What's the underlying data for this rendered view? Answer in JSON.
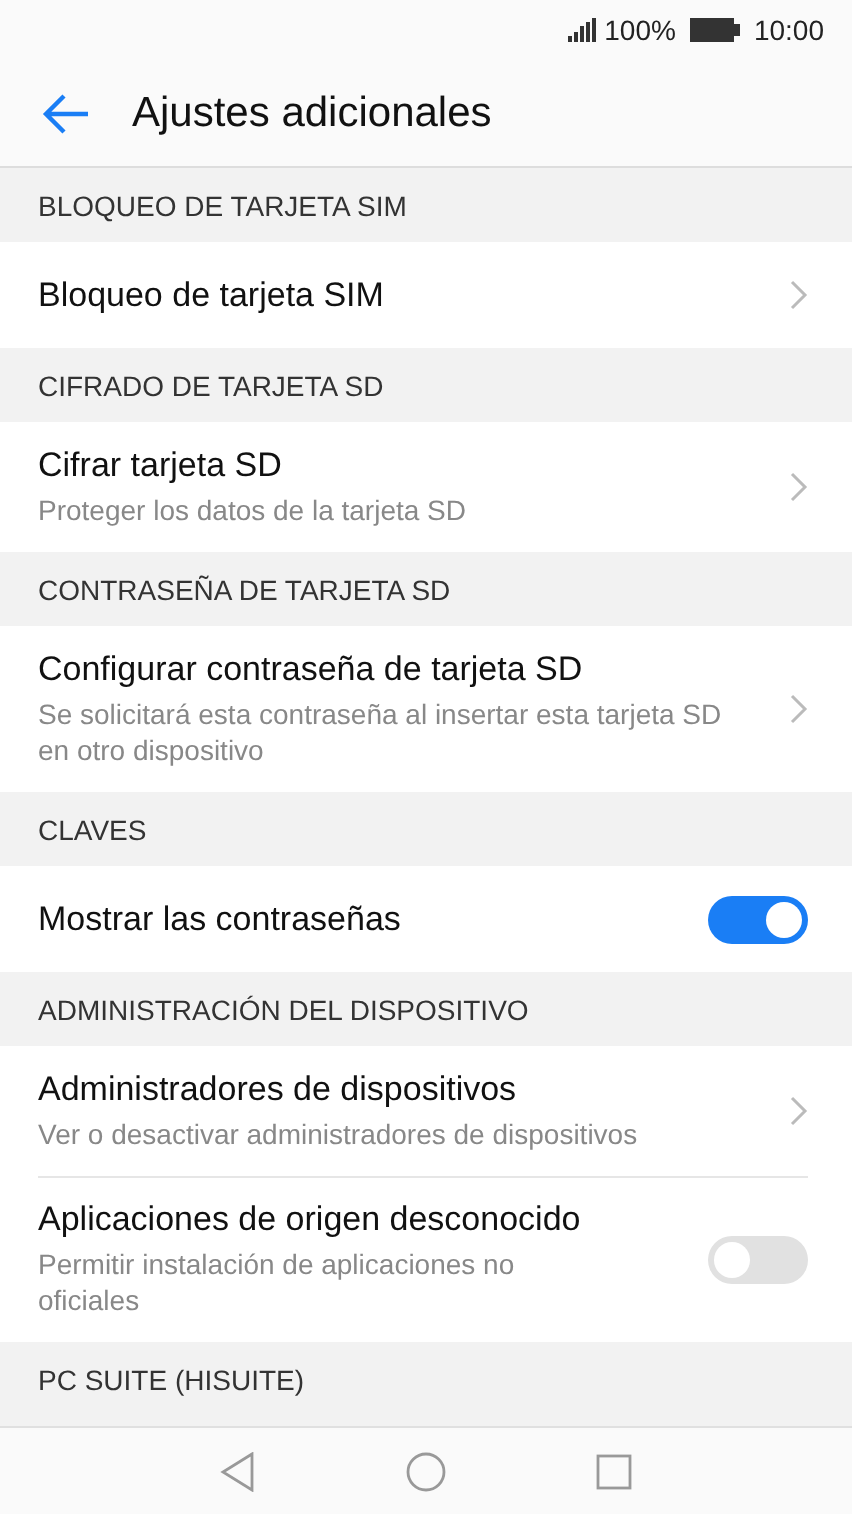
{
  "status_bar": {
    "battery_text": "100%",
    "time": "10:00"
  },
  "app_bar": {
    "title": "Ajustes adicionales"
  },
  "sections": [
    {
      "header": "BLOQUEO DE TARJETA SIM",
      "items": [
        {
          "kind": "link",
          "title": "Bloqueo de tarjeta SIM"
        }
      ]
    },
    {
      "header": "CIFRADO DE TARJETA SD",
      "items": [
        {
          "kind": "link",
          "title": "Cifrar tarjeta SD",
          "subtitle": "Proteger los datos de la tarjeta SD"
        }
      ]
    },
    {
      "header": "CONTRASEÑA DE TARJETA SD",
      "items": [
        {
          "kind": "link",
          "title": "Configurar contraseña de tarjeta SD",
          "subtitle": "Se solicitará esta contraseña al insertar esta tarjeta SD en otro dispositivo"
        }
      ]
    },
    {
      "header": "CLAVES",
      "items": [
        {
          "kind": "switch",
          "title": "Mostrar las contraseñas",
          "on": true
        }
      ]
    },
    {
      "header": "ADMINISTRACIÓN DEL DISPOSITIVO",
      "items": [
        {
          "kind": "link",
          "title": "Administradores de dispositivos",
          "subtitle": "Ver o desactivar administradores de dispositivos"
        },
        {
          "kind": "switch",
          "title": "Aplicaciones de origen desconocido",
          "subtitle": "Permitir instalación de aplicaciones no oficiales",
          "on": false
        }
      ]
    },
    {
      "header": "PC SUITE (HISUITE)"
    }
  ]
}
